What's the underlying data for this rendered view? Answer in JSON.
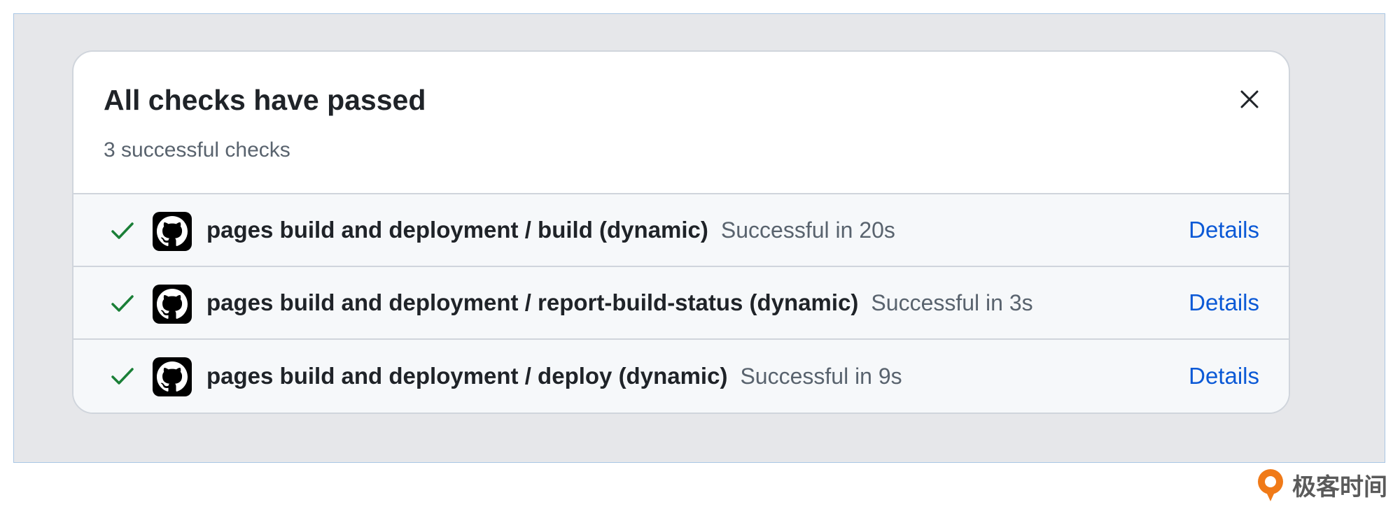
{
  "panel": {
    "title": "All checks have passed",
    "subtitle": "3 successful checks"
  },
  "checks": [
    {
      "name": "pages build and deployment / build (dynamic)",
      "status": "Successful in 20s",
      "details_label": "Details"
    },
    {
      "name": "pages build and deployment / report-build-status (dynamic)",
      "status": "Successful in 3s",
      "details_label": "Details"
    },
    {
      "name": "pages build and deployment / deploy (dynamic)",
      "status": "Successful in 9s",
      "details_label": "Details"
    }
  ],
  "icons": {
    "close": "close-icon",
    "check": "checkmark-icon",
    "provider": "github-icon"
  },
  "watermark": {
    "text": "极客时间"
  },
  "colors": {
    "success": "#1a7f37",
    "link": "#0b59d6",
    "brand": "#f07a18"
  }
}
